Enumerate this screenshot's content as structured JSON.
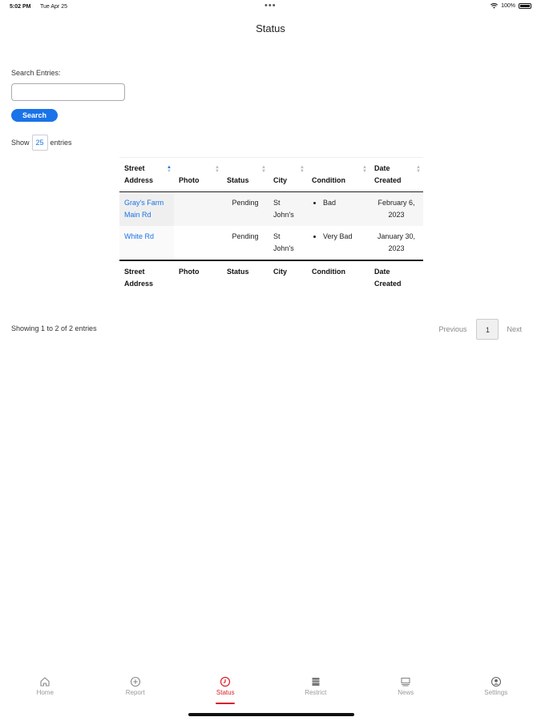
{
  "status_bar": {
    "time": "5:02 PM",
    "date": "Tue Apr 25",
    "dots": "•••",
    "battery": "100%"
  },
  "page": {
    "title": "Status"
  },
  "search": {
    "label": "Search Entries:",
    "placeholder": "",
    "button_label": "Search"
  },
  "length": {
    "prefix": "Show",
    "value": "25",
    "suffix": "entries"
  },
  "table": {
    "headers": [
      "Street Address",
      "Photo",
      "Status",
      "City",
      "Condition",
      "Date Created"
    ],
    "rows": [
      {
        "address": "Gray's Farm Main Rd",
        "photo": "",
        "status": "Pending",
        "city": "St John's",
        "condition": "Bad",
        "date": "February 6, 2023"
      },
      {
        "address": "White Rd",
        "photo": "",
        "status": "Pending",
        "city": "St John's",
        "condition": "Very Bad",
        "date": "January 30, 2023"
      }
    ]
  },
  "info": "Showing 1 to 2 of 2 entries",
  "pagination": {
    "previous": "Previous",
    "current": "1",
    "next": "Next"
  },
  "tabs": [
    {
      "label": "Home",
      "icon": "home-icon",
      "active": false
    },
    {
      "label": "Report",
      "icon": "plus-circle-icon",
      "active": false
    },
    {
      "label": "Status",
      "icon": "clock-icon",
      "active": true
    },
    {
      "label": "Restrict",
      "icon": "restrict-icon",
      "active": false
    },
    {
      "label": "News",
      "icon": "news-icon",
      "active": false
    },
    {
      "label": "Settings",
      "icon": "user-circle-icon",
      "active": false
    }
  ],
  "colors": {
    "accent": "#1a73e8",
    "active_tab": "#d91f26",
    "inactive_tab": "#999999"
  }
}
